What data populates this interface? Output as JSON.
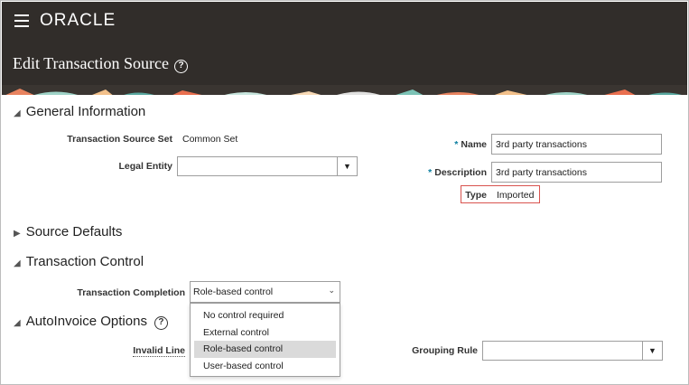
{
  "header": {
    "logo": "ORACLE",
    "page_title": "Edit Transaction Source",
    "help_glyph": "?"
  },
  "general": {
    "section_title": "General Information",
    "transaction_source_set_label": "Transaction Source Set",
    "transaction_source_set_value": "Common Set",
    "legal_entity_label": "Legal Entity",
    "legal_entity_value": "",
    "name_label": "Name",
    "name_value": "3rd party transactions",
    "description_label": "Description",
    "description_value": "3rd party transactions",
    "type_label": "Type",
    "type_value": "Imported",
    "required_mark": "*"
  },
  "source_defaults": {
    "section_title": "Source Defaults"
  },
  "transaction_control": {
    "section_title": "Transaction Control",
    "completion_label": "Transaction Completion",
    "completion_value": "Role-based control",
    "options": [
      "No control required",
      "External control",
      "Role-based control",
      "User-based control"
    ],
    "selected_index": 2
  },
  "autoinvoice": {
    "section_title": "AutoInvoice Options",
    "invalid_line_label": "Invalid Line",
    "grouping_rule_label": "Grouping Rule",
    "grouping_rule_value": ""
  },
  "colors": {
    "header_bg": "#312d2a",
    "required_star": "#0a7ea0",
    "highlight_border": "#d9534f",
    "selected_option_bg": "#dadada"
  }
}
